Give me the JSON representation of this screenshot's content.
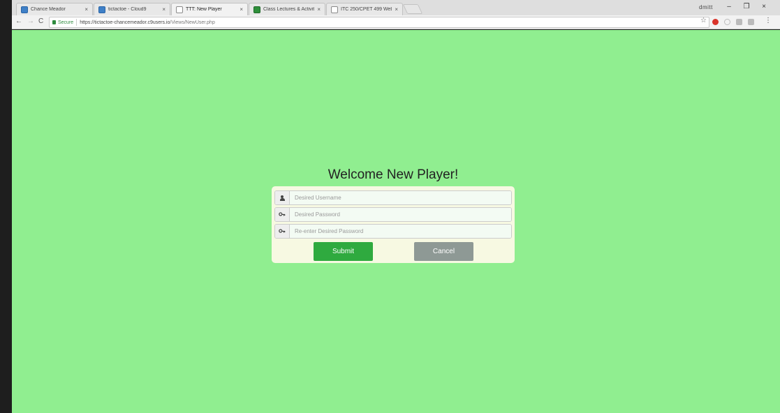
{
  "browser": {
    "tabs": [
      {
        "title": "Chance Meador",
        "favicon": "blue-square-icon",
        "active": false
      },
      {
        "title": "tictactoe - Cloud9",
        "favicon": "blue-square-icon",
        "active": false
      },
      {
        "title": "TTT: New Player",
        "favicon": "document-icon",
        "active": true
      },
      {
        "title": "Class Lectures & Activiti...",
        "favicon": "green-square-icon",
        "active": false
      },
      {
        "title": "ITC 250/CPET 499 Web ...",
        "favicon": "document-icon",
        "active": false
      }
    ],
    "tab_close_glyph": "×",
    "window_user": "dmitt",
    "window_controls": {
      "minimize": "–",
      "restore": "❐",
      "close": "×"
    },
    "nav": {
      "back": "←",
      "forward": "→",
      "reload": "C"
    },
    "address": {
      "secure_label": "Secure",
      "url_origin": "https://tictactoe-chancemeador.c9users.io",
      "url_path": "/Views/NewUser.php"
    },
    "star_glyph": "☆"
  },
  "page": {
    "background_color": "#90ee90",
    "heading": "Welcome New Player!",
    "fields": {
      "username_placeholder": "Desired Username",
      "password_placeholder": "Desired Password",
      "confirm_placeholder": "Re-enter Desired Password"
    },
    "buttons": {
      "submit": "Submit",
      "cancel": "Cancel"
    },
    "colors": {
      "submit": "#2faa3f",
      "cancel": "#8e9995",
      "panel": "#f7f9e2"
    }
  }
}
